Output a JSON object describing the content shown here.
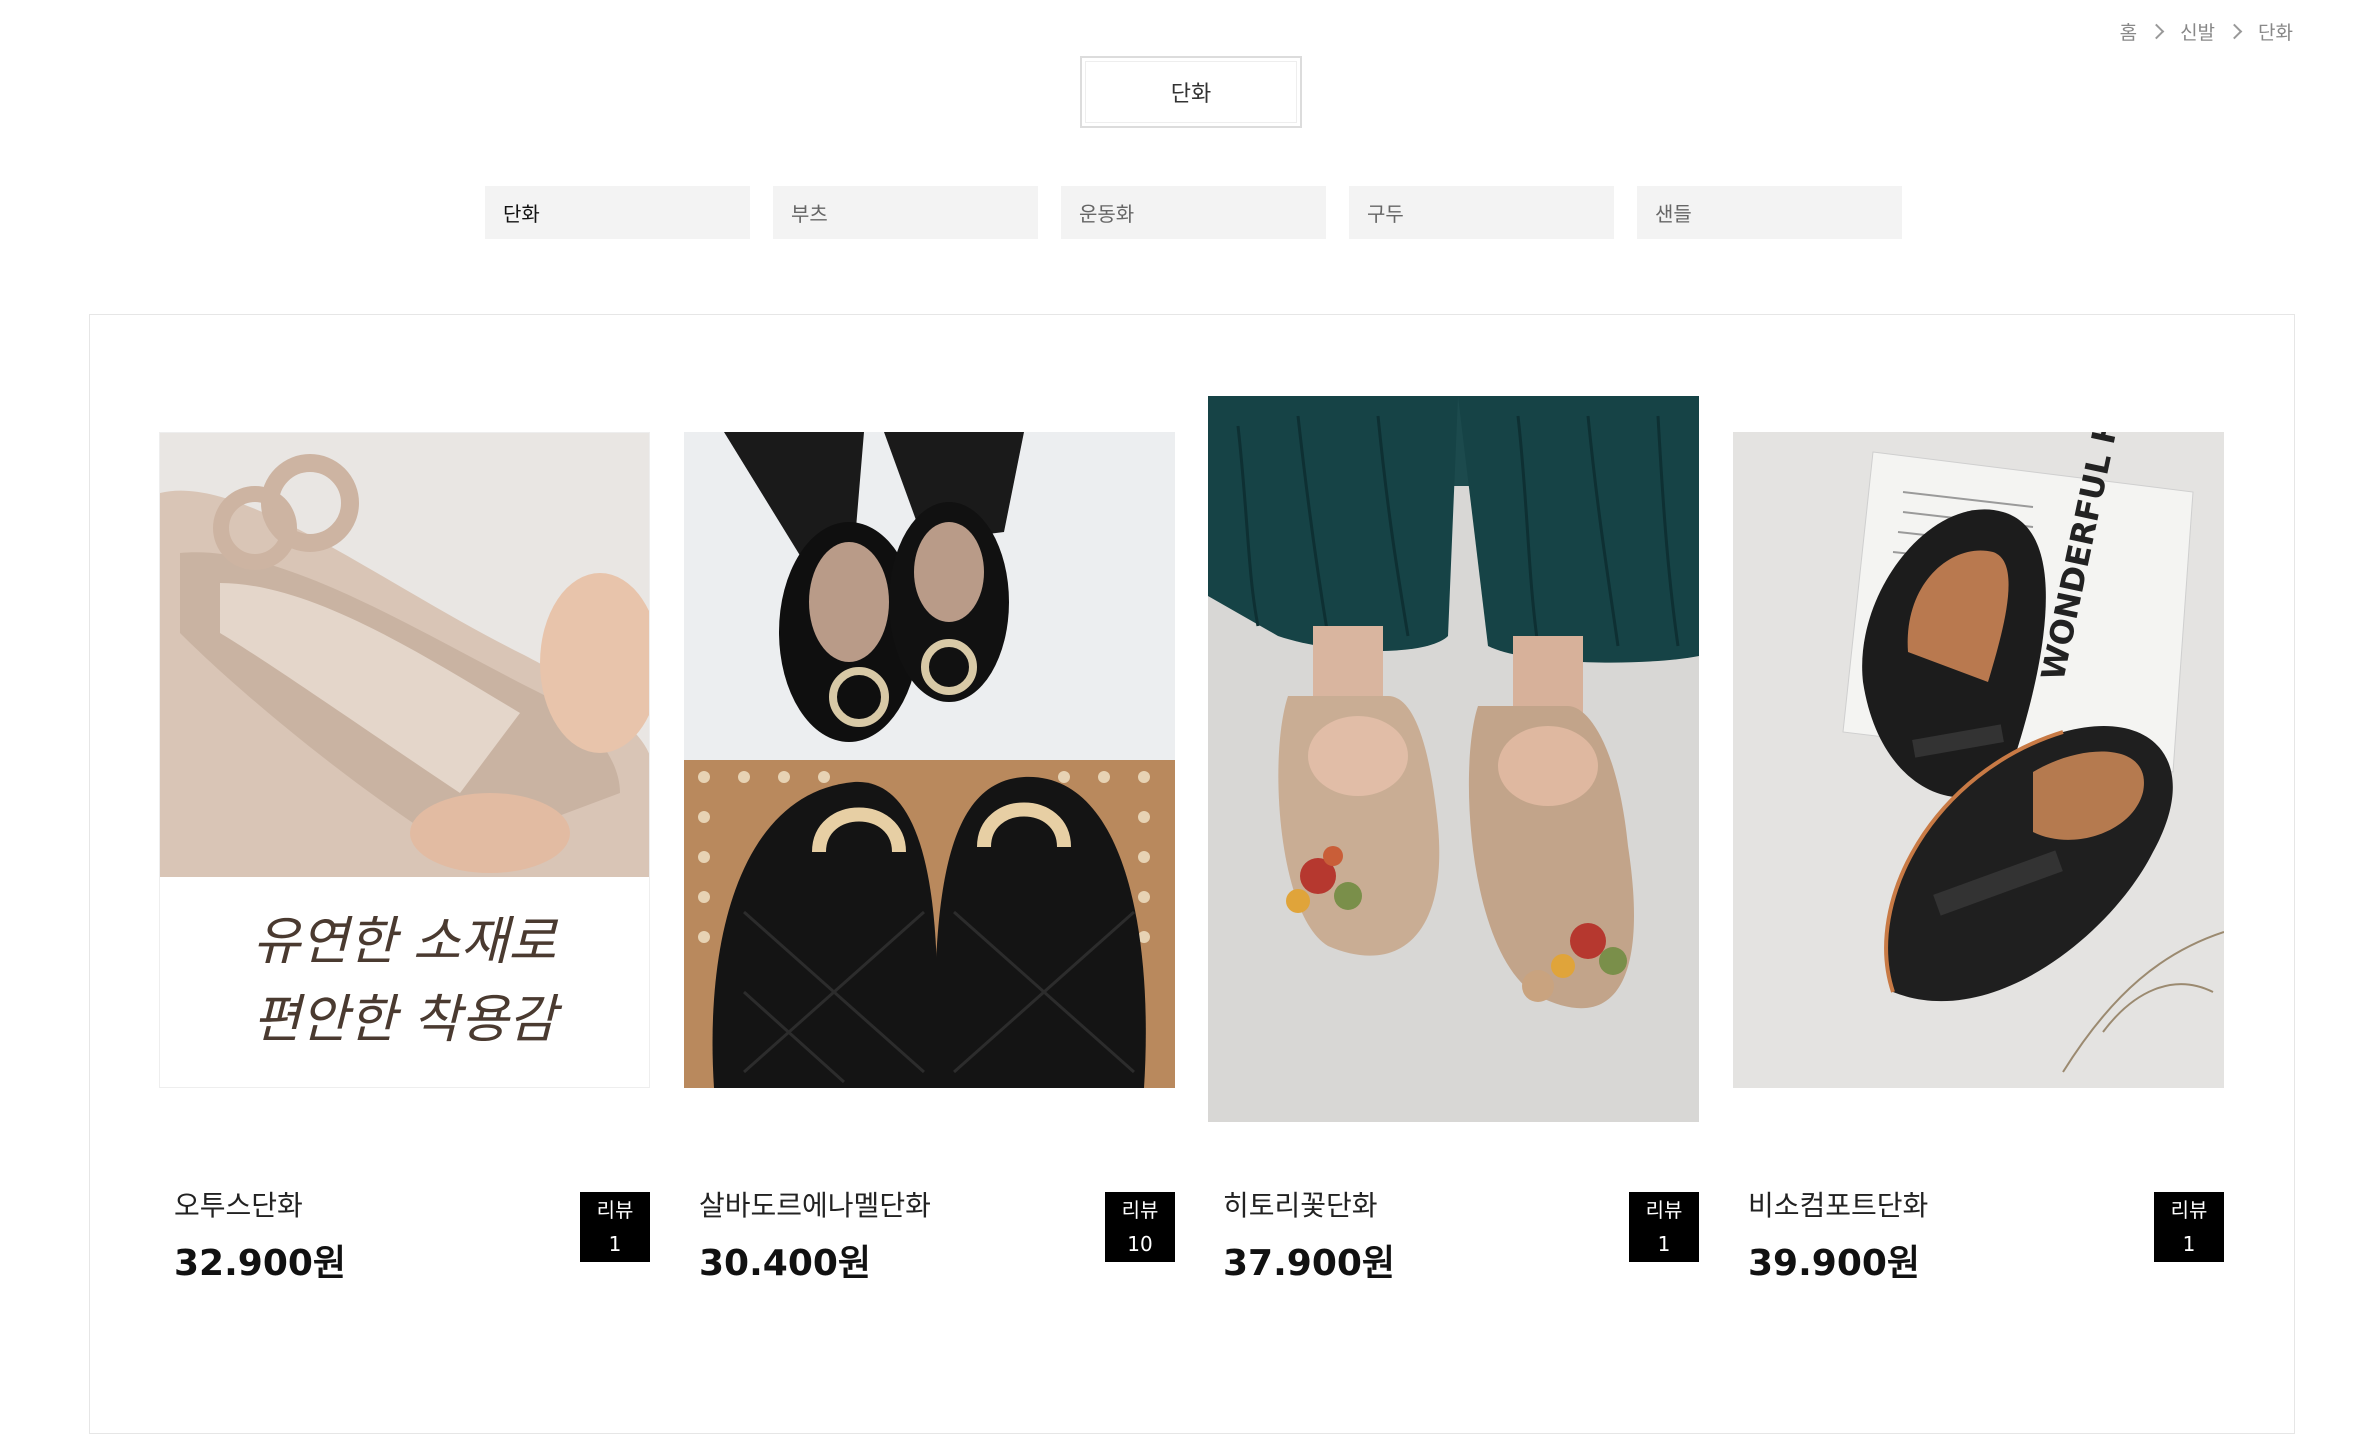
{
  "breadcrumb": [
    "홈",
    "신발",
    "단화"
  ],
  "category_title": "단화",
  "tabs": [
    {
      "label": "단화",
      "active": true
    },
    {
      "label": "부츠",
      "active": false
    },
    {
      "label": "운동화",
      "active": false
    },
    {
      "label": "구두",
      "active": false
    },
    {
      "label": "샌들",
      "active": false
    }
  ],
  "products": [
    {
      "name": "오투스단화",
      "price": "32.900원",
      "review_label": "리뷰",
      "review_count": "1",
      "overlay_line1": "유연한 소재로",
      "overlay_line2": "편안한 착용감"
    },
    {
      "name": "살바도르에나멜단화",
      "price": "30.400원",
      "review_label": "리뷰",
      "review_count": "10"
    },
    {
      "name": "히토리꽃단화",
      "price": "37.900원",
      "review_label": "리뷰",
      "review_count": "1"
    },
    {
      "name": "비소컴포트단화",
      "price": "39.900원",
      "review_label": "리뷰",
      "review_count": "1",
      "magazine_text": "WONDERFUL HOMELIFE"
    }
  ]
}
